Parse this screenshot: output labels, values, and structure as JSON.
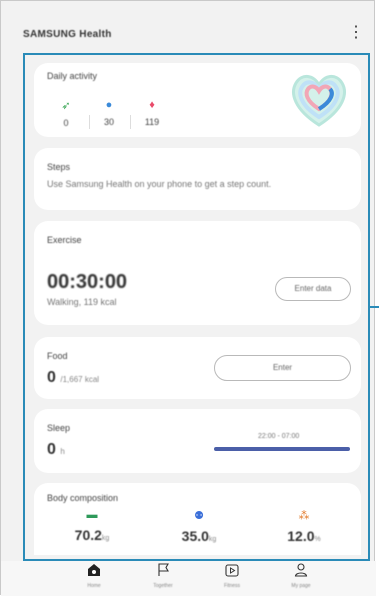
{
  "header": {
    "title": "SAMSUNG Health",
    "more_icon": "more-vertical-icon"
  },
  "cards": {
    "daily_activity": {
      "title": "Daily activity",
      "stats": [
        {
          "icon": "steps-icon",
          "value": "0",
          "color": "#3aa655"
        },
        {
          "icon": "active-time-icon",
          "value": "30",
          "color": "#3b8ad9"
        },
        {
          "icon": "calorie-icon",
          "value": "119",
          "color": "#e94b6a"
        }
      ]
    },
    "steps": {
      "title": "Steps",
      "description": "Use Samsung Health on your phone to get a step count."
    },
    "exercise": {
      "title": "Exercise",
      "time": "00:30:00",
      "detail": "Walking, 119 kcal",
      "button": "Enter data"
    },
    "food": {
      "title": "Food",
      "value": "0",
      "unit": "/1,667 kcal",
      "button": "Enter"
    },
    "sleep": {
      "title": "Sleep",
      "value": "0",
      "unit": "h",
      "range": "22:00 - 07:00"
    },
    "body_composition": {
      "title": "Body composition",
      "items": [
        {
          "icon": "body-fat-icon",
          "value": "70.2",
          "unit": "kg",
          "color": "#2e9a5a"
        },
        {
          "icon": "skeletal-muscle-icon",
          "value": "35.0",
          "unit": "kg",
          "color": "#3b6fd9"
        },
        {
          "icon": "body-water-icon",
          "value": "12.0",
          "unit": "%",
          "color": "#e27a2b"
        }
      ]
    }
  },
  "nav": [
    {
      "label": "Home",
      "icon": "home-icon"
    },
    {
      "label": "Together",
      "icon": "flag-icon"
    },
    {
      "label": "Fitness",
      "icon": "play-icon"
    },
    {
      "label": "My page",
      "icon": "person-icon"
    }
  ]
}
